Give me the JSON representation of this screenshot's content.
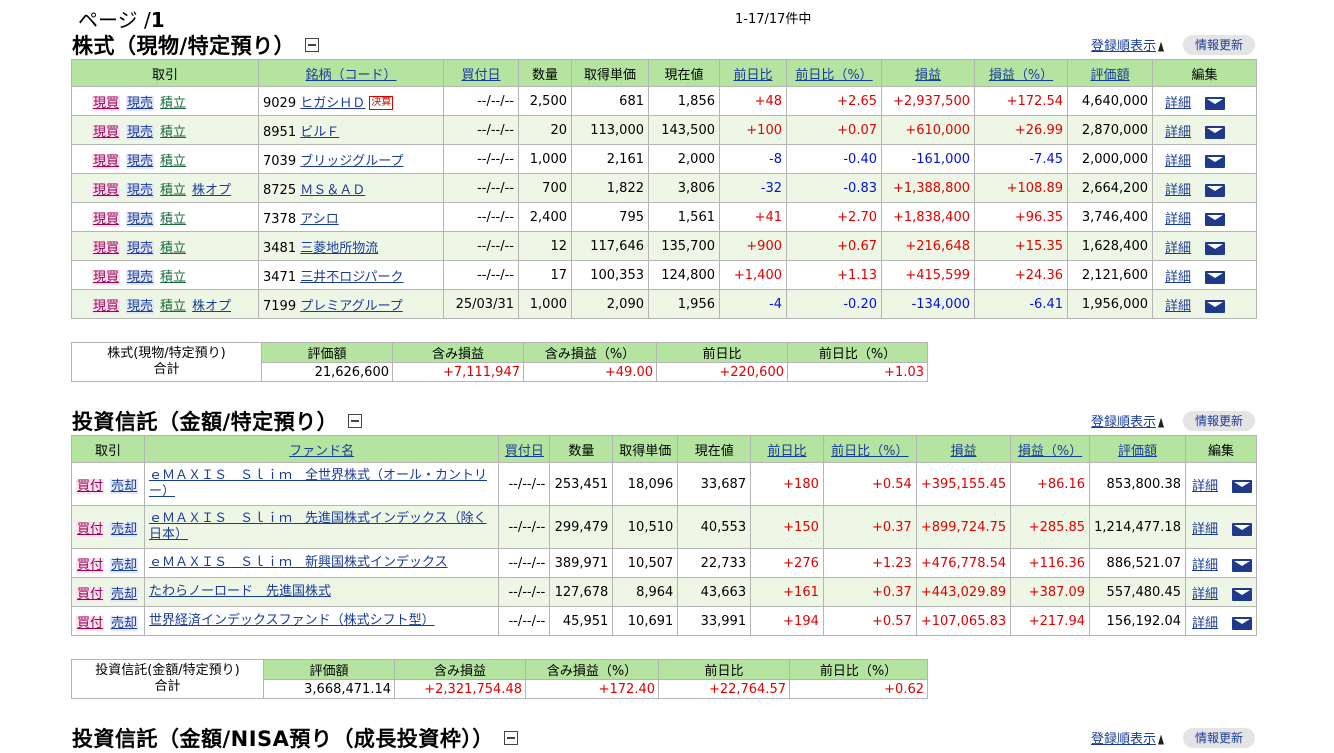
{
  "pager": {
    "prefix": "ページ /",
    "total": "1"
  },
  "count": "1-17/17件中",
  "sections": {
    "stocks": {
      "title": "株式（現物/特定預り）"
    },
    "funds": {
      "title": "投資信託（金額/特定預り）"
    },
    "nisa": {
      "title": "投資信託（金額/NISA預り（成長投資枠））"
    }
  },
  "reg_label": "登録順表示",
  "refresh_label": "情報更新",
  "stock_headers": [
    "取引",
    "銘柄（コード）",
    "買付日",
    "数量",
    "取得単価",
    "現在値",
    "前日比",
    "前日比（%）",
    "損益",
    "損益（%）",
    "評価額",
    "編集"
  ],
  "stock_rows": [
    {
      "code": "9029",
      "name": "ヒガシＨＤ",
      "kessan": "決算",
      "date": "--/--/--",
      "qty": "2,500",
      "cost": "681",
      "price": "1,856",
      "chg": "+48",
      "chgp": "+2.65",
      "pl": "+2,937,500",
      "plp": "+172.54",
      "value": "4,640,000",
      "kabuop": ""
    },
    {
      "code": "8951",
      "name": "ビルＦ",
      "kessan": "",
      "date": "--/--/--",
      "qty": "20",
      "cost": "113,000",
      "price": "143,500",
      "chg": "+100",
      "chgp": "+0.07",
      "pl": "+610,000",
      "plp": "+26.99",
      "value": "2,870,000",
      "kabuop": ""
    },
    {
      "code": "7039",
      "name": "ブリッジグループ",
      "kessan": "",
      "date": "--/--/--",
      "qty": "1,000",
      "cost": "2,161",
      "price": "2,000",
      "chg": "-8",
      "chgp": "-0.40",
      "pl": "-161,000",
      "plp": "-7.45",
      "value": "2,000,000",
      "kabuop": ""
    },
    {
      "code": "8725",
      "name": "ＭＳ＆ＡＤ",
      "kessan": "",
      "date": "--/--/--",
      "qty": "700",
      "cost": "1,822",
      "price": "3,806",
      "chg": "-32",
      "chgp": "-0.83",
      "pl": "+1,388,800",
      "plp": "+108.89",
      "value": "2,664,200",
      "kabuop": "株オプ"
    },
    {
      "code": "7378",
      "name": "アシロ",
      "kessan": "",
      "date": "--/--/--",
      "qty": "2,400",
      "cost": "795",
      "price": "1,561",
      "chg": "+41",
      "chgp": "+2.70",
      "pl": "+1,838,400",
      "plp": "+96.35",
      "value": "3,746,400",
      "kabuop": ""
    },
    {
      "code": "3481",
      "name": "三菱地所物流",
      "kessan": "",
      "date": "--/--/--",
      "qty": "12",
      "cost": "117,646",
      "price": "135,700",
      "chg": "+900",
      "chgp": "+0.67",
      "pl": "+216,648",
      "plp": "+15.35",
      "value": "1,628,400",
      "kabuop": ""
    },
    {
      "code": "3471",
      "name": "三井不ロジパーク",
      "kessan": "",
      "date": "--/--/--",
      "qty": "17",
      "cost": "100,353",
      "price": "124,800",
      "chg": "+1,400",
      "chgp": "+1.13",
      "pl": "+415,599",
      "plp": "+24.36",
      "value": "2,121,600",
      "kabuop": ""
    },
    {
      "code": "7199",
      "name": "プレミアグループ",
      "kessan": "",
      "date": "25/03/31",
      "qty": "1,000",
      "cost": "2,090",
      "price": "1,956",
      "chg": "-4",
      "chgp": "-0.20",
      "pl": "-134,000",
      "plp": "-6.41",
      "value": "1,956,000",
      "kabuop": "株オプ"
    }
  ],
  "stock_actions": {
    "buy": "現買",
    "sell": "現売",
    "tsumi": "積立",
    "detail": "詳細"
  },
  "summary_headers": [
    "評価額",
    "含み損益",
    "含み損益（%）",
    "前日比",
    "前日比（%）"
  ],
  "stock_summary": {
    "label1": "株式(現物/特定預り)",
    "label2": "合計",
    "values": [
      "21,626,600",
      "+7,111,947",
      "+49.00",
      "+220,600",
      "+1.03"
    ]
  },
  "fund_headers": [
    "取引",
    "ファンド名",
    "買付日",
    "数量",
    "取得単価",
    "現在値",
    "前日比",
    "前日比（%）",
    "損益",
    "損益（%）",
    "評価額",
    "編集"
  ],
  "fund_actions": {
    "buy": "買付",
    "sell": "売却",
    "detail": "詳細"
  },
  "fund_rows": [
    {
      "name": "ｅＭＡＸＩＳ　Ｓｌｉｍ　全世界株式（オール・カントリー）",
      "date": "--/--/--",
      "qty": "253,451",
      "cost": "18,096",
      "price": "33,687",
      "chg": "+180",
      "chgp": "+0.54",
      "pl": "+395,155.45",
      "plp": "+86.16",
      "value": "853,800.38"
    },
    {
      "name": "ｅＭＡＸＩＳ　Ｓｌｉｍ　先進国株式インデックス（除く日本）",
      "date": "--/--/--",
      "qty": "299,479",
      "cost": "10,510",
      "price": "40,553",
      "chg": "+150",
      "chgp": "+0.37",
      "pl": "+899,724.75",
      "plp": "+285.85",
      "value": "1,214,477.18"
    },
    {
      "name": "ｅＭＡＸＩＳ　Ｓｌｉｍ　新興国株式インデックス",
      "date": "--/--/--",
      "qty": "389,971",
      "cost": "10,507",
      "price": "22,733",
      "chg": "+276",
      "chgp": "+1.23",
      "pl": "+476,778.54",
      "plp": "+116.36",
      "value": "886,521.07"
    },
    {
      "name": "たわらノーロード　先進国株式",
      "date": "--/--/--",
      "qty": "127,678",
      "cost": "8,964",
      "price": "43,663",
      "chg": "+161",
      "chgp": "+0.37",
      "pl": "+443,029.89",
      "plp": "+387.09",
      "value": "557,480.45"
    },
    {
      "name": "世界経済インデックスファンド（株式シフト型）",
      "date": "--/--/--",
      "qty": "45,951",
      "cost": "10,691",
      "price": "33,991",
      "chg": "+194",
      "chgp": "+0.57",
      "pl": "+107,065.83",
      "plp": "+217.94",
      "value": "156,192.04"
    }
  ],
  "fund_summary": {
    "label1": "投資信託(金額/特定預り)",
    "label2": "合計",
    "values": [
      "3,668,471.14",
      "+2,321,754.48",
      "+172.40",
      "+22,764.57",
      "+0.62"
    ]
  },
  "colors": {
    "header_green": "#b4e4a0",
    "row_alt": "#eef7e6",
    "positive": "#e00000",
    "negative": "#0011dd",
    "link": "#1a3c99"
  }
}
